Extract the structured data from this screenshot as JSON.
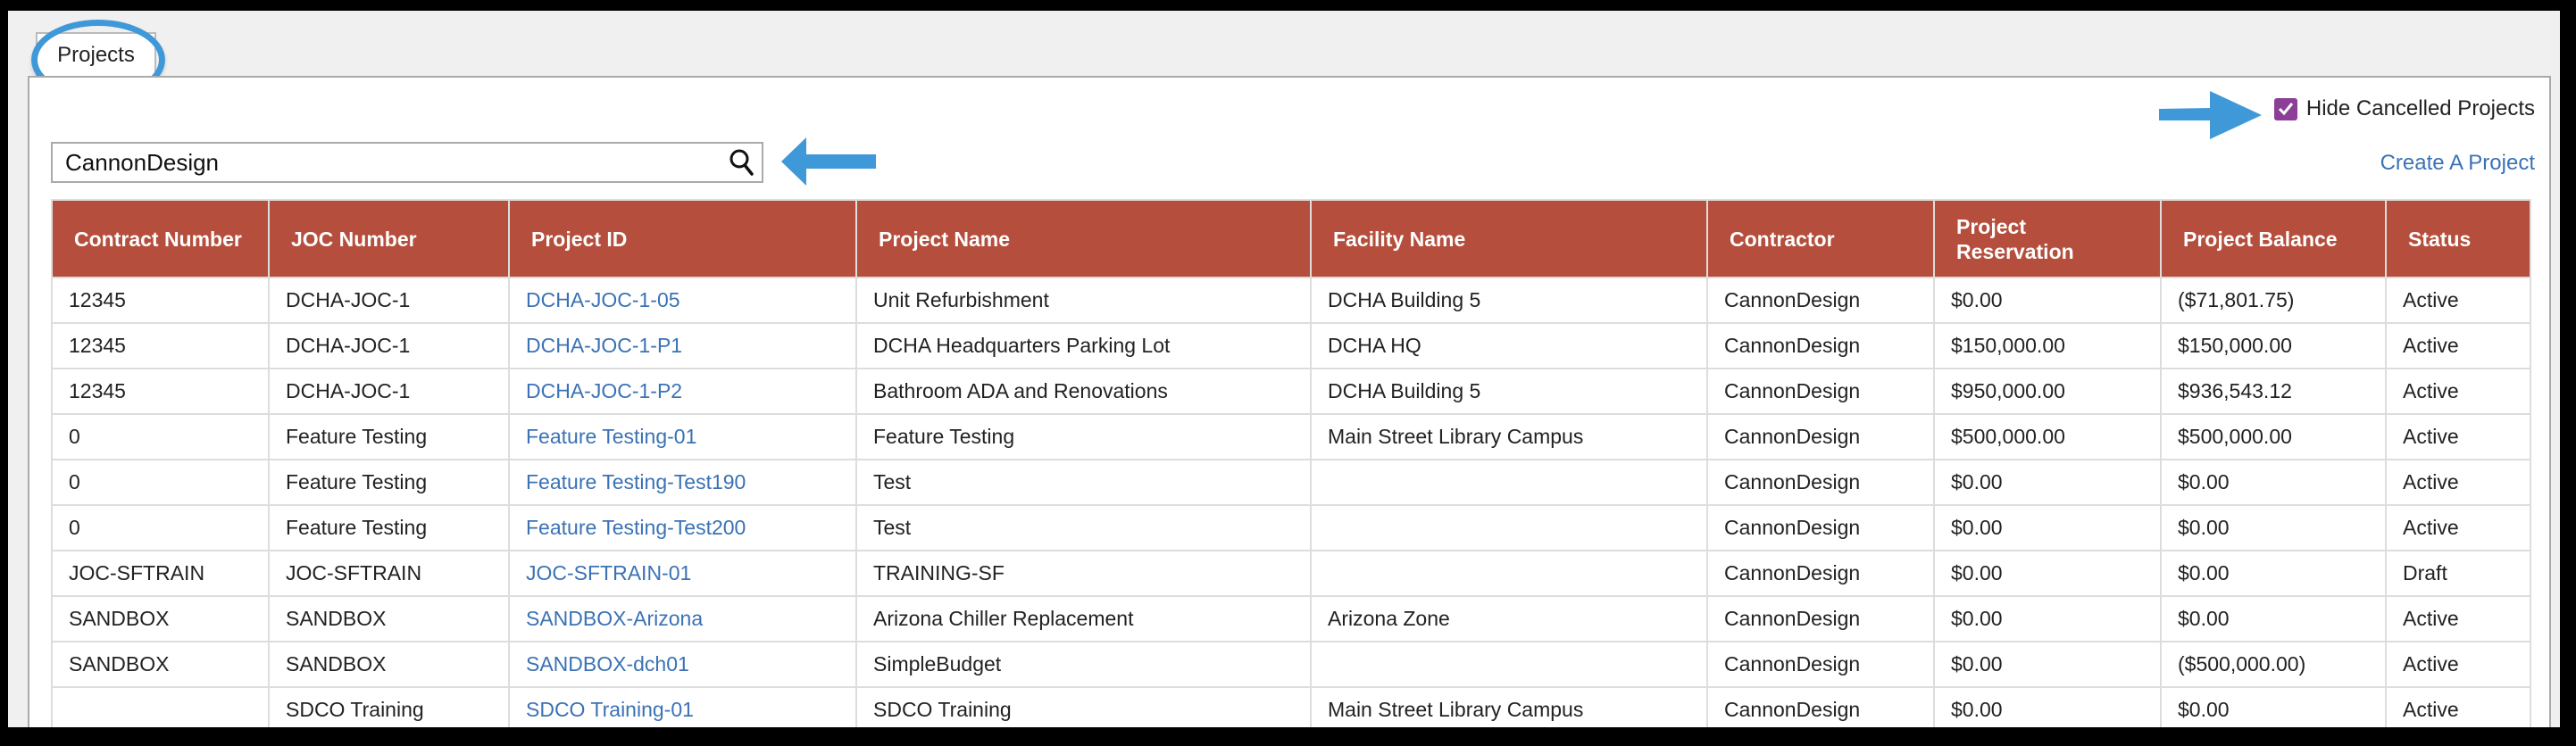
{
  "tab": {
    "label": "Projects"
  },
  "search": {
    "value": "CannonDesign",
    "icon": "search-icon"
  },
  "hide_cancelled": {
    "label": "Hide Cancelled Projects",
    "checked": true
  },
  "create_link": "Create A Project",
  "colors": {
    "header": "#b54e3c",
    "link": "#3a72b5",
    "checkbox": "#8b3f96",
    "annotation": "#3f98d8"
  },
  "table": {
    "columns": [
      "Contract Number",
      "JOC Number",
      "Project ID",
      "Project Name",
      "Facility Name",
      "Contractor",
      "Project Reservation",
      "Project Balance",
      "Status"
    ],
    "rows": [
      [
        "12345",
        "DCHA-JOC-1",
        "DCHA-JOC-1-05",
        "Unit Refurbishment",
        "DCHA Building 5",
        "CannonDesign",
        "$0.00",
        "($71,801.75)",
        "Active"
      ],
      [
        "12345",
        "DCHA-JOC-1",
        "DCHA-JOC-1-P1",
        "DCHA Headquarters Parking Lot",
        "DCHA HQ",
        "CannonDesign",
        "$150,000.00",
        "$150,000.00",
        "Active"
      ],
      [
        "12345",
        "DCHA-JOC-1",
        "DCHA-JOC-1-P2",
        "Bathroom ADA and Renovations",
        "DCHA Building 5",
        "CannonDesign",
        "$950,000.00",
        "$936,543.12",
        "Active"
      ],
      [
        "0",
        "Feature Testing",
        "Feature Testing-01",
        "Feature Testing",
        "Main Street Library Campus",
        "CannonDesign",
        "$500,000.00",
        "$500,000.00",
        "Active"
      ],
      [
        "0",
        "Feature Testing",
        "Feature Testing-Test190",
        "Test",
        "",
        "CannonDesign",
        "$0.00",
        "$0.00",
        "Active"
      ],
      [
        "0",
        "Feature Testing",
        "Feature Testing-Test200",
        "Test",
        "",
        "CannonDesign",
        "$0.00",
        "$0.00",
        "Active"
      ],
      [
        "JOC-SFTRAIN",
        "JOC-SFTRAIN",
        "JOC-SFTRAIN-01",
        "TRAINING-SF",
        "",
        "CannonDesign",
        "$0.00",
        "$0.00",
        "Draft"
      ],
      [
        "SANDBOX",
        "SANDBOX",
        "SANDBOX-Arizona",
        "Arizona Chiller Replacement",
        "Arizona Zone",
        "CannonDesign",
        "$0.00",
        "$0.00",
        "Active"
      ],
      [
        "SANDBOX",
        "SANDBOX",
        "SANDBOX-dch01",
        "SimpleBudget",
        "",
        "CannonDesign",
        "$0.00",
        "($500,000.00)",
        "Active"
      ],
      [
        "",
        "SDCO Training",
        "SDCO Training-01",
        "SDCO Training",
        "Main Street Library Campus",
        "CannonDesign",
        "$0.00",
        "$0.00",
        "Active"
      ]
    ]
  }
}
